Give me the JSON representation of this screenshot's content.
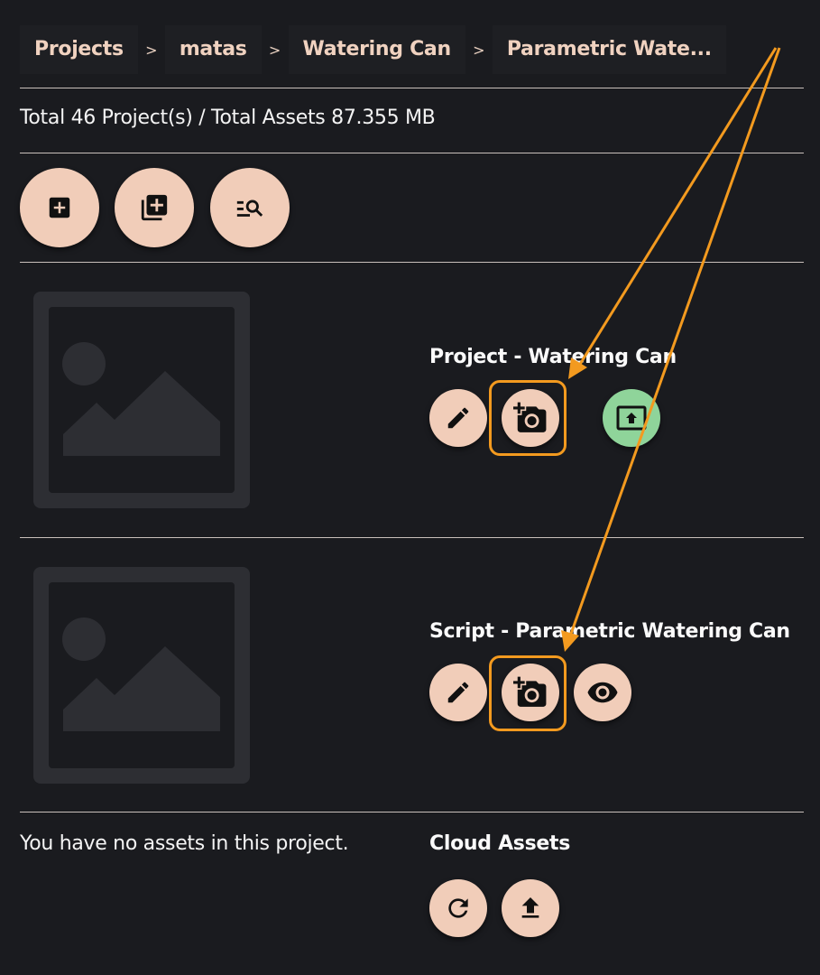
{
  "breadcrumb": [
    {
      "label": "Projects"
    },
    {
      "label": "matas"
    },
    {
      "label": "Watering Can"
    },
    {
      "label": "Parametric Wate..."
    }
  ],
  "breadcrumb_separator": ">",
  "summary": "Total 46 Project(s) / Total Assets 87.355 MB",
  "toolbar": {
    "buttons": [
      {
        "name": "add-project-button",
        "icon": "add-box-icon"
      },
      {
        "name": "add-multiple-button",
        "icon": "library-add-icon"
      },
      {
        "name": "search-projects-button",
        "icon": "manage-search-icon"
      }
    ]
  },
  "items": [
    {
      "title": "Project - Watering Can",
      "thumbnail_icon": "image-placeholder-icon",
      "actions": [
        {
          "name": "edit-button",
          "icon": "pencil-icon"
        },
        {
          "name": "add-photo-button",
          "icon": "add-a-photo-icon",
          "highlighted": true
        },
        {
          "name": "present-button",
          "icon": "present-to-all-icon",
          "color": "#8fd49a"
        }
      ]
    },
    {
      "title": "Script - Parametric Watering Can",
      "thumbnail_icon": "image-placeholder-icon",
      "actions": [
        {
          "name": "edit-button",
          "icon": "pencil-icon"
        },
        {
          "name": "add-photo-button",
          "icon": "add-a-photo-icon",
          "highlighted": true
        },
        {
          "name": "view-button",
          "icon": "eye-icon"
        }
      ]
    }
  ],
  "assets": {
    "empty_message": "You have no assets in this project.",
    "cloud_title": "Cloud Assets",
    "actions": [
      {
        "name": "refresh-button",
        "icon": "refresh-icon"
      },
      {
        "name": "upload-button",
        "icon": "upload-icon"
      }
    ]
  },
  "colors": {
    "background": "#1a1b1f",
    "button": "#f1cdb9",
    "button_green": "#8fd49a",
    "breadcrumb_text": "#f0d2c0",
    "annotation": "#f39a1f"
  }
}
